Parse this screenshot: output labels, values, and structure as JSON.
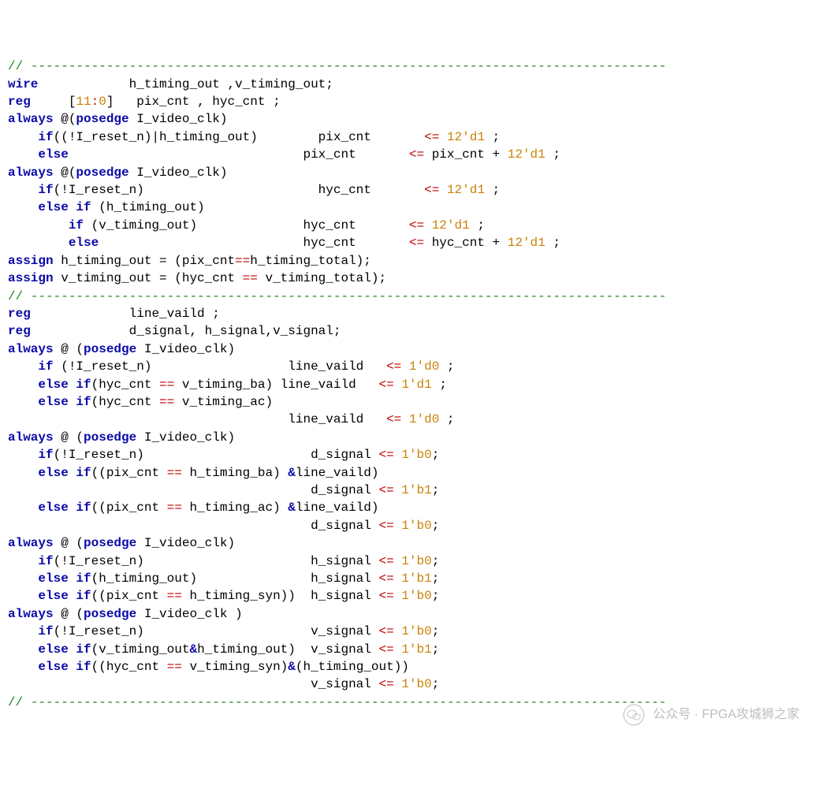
{
  "tokens": [
    [
      [
        "c",
        "// ------------------------------------------------------------------------------------"
      ]
    ],
    [
      [
        "k",
        "wire"
      ],
      [
        "",
        "            h_timing_out ,v_timing_out;"
      ]
    ],
    [
      [
        "k",
        "reg"
      ],
      [
        "",
        "     ["
      ],
      [
        "o",
        "11"
      ],
      [
        "r",
        ":"
      ],
      [
        "o",
        "0"
      ],
      [
        "",
        "]   pix_cnt , hyc_cnt ;"
      ]
    ],
    [
      [
        "k",
        "always"
      ],
      [
        "",
        " @("
      ],
      [
        "k",
        "posedge"
      ],
      [
        "",
        " I_video_clk)"
      ]
    ],
    [
      [
        "",
        "    "
      ],
      [
        "k",
        "if"
      ],
      [
        "",
        "((!I_reset_n)|h_timing_out)        pix_cnt       "
      ],
      [
        "r",
        "<="
      ],
      [
        "",
        " "
      ],
      [
        "o",
        "12'd1"
      ],
      [
        "",
        " ;"
      ]
    ],
    [
      [
        "",
        "    "
      ],
      [
        "k",
        "else"
      ],
      [
        "",
        "                               pix_cnt       "
      ],
      [
        "r",
        "<="
      ],
      [
        "",
        " pix_cnt + "
      ],
      [
        "o",
        "12'd1"
      ],
      [
        "",
        " ;"
      ]
    ],
    [
      [
        "k",
        "always"
      ],
      [
        "",
        " @("
      ],
      [
        "k",
        "posedge"
      ],
      [
        "",
        " I_video_clk)"
      ]
    ],
    [
      [
        "",
        "    "
      ],
      [
        "k",
        "if"
      ],
      [
        "",
        "(!I_reset_n)                       hyc_cnt       "
      ],
      [
        "r",
        "<="
      ],
      [
        "",
        " "
      ],
      [
        "o",
        "12'd1"
      ],
      [
        "",
        " ;"
      ]
    ],
    [
      [
        "",
        "    "
      ],
      [
        "k",
        "else if"
      ],
      [
        "",
        " (h_timing_out)"
      ]
    ],
    [
      [
        "",
        "        "
      ],
      [
        "k",
        "if"
      ],
      [
        "",
        " (v_timing_out)              hyc_cnt       "
      ],
      [
        "r",
        "<="
      ],
      [
        "",
        " "
      ],
      [
        "o",
        "12'd1"
      ],
      [
        "",
        " ;"
      ]
    ],
    [
      [
        "",
        "        "
      ],
      [
        "k",
        "else"
      ],
      [
        "",
        "                           hyc_cnt       "
      ],
      [
        "r",
        "<="
      ],
      [
        "",
        " hyc_cnt + "
      ],
      [
        "o",
        "12'd1"
      ],
      [
        "",
        " ;"
      ]
    ],
    [
      [
        "k",
        "assign"
      ],
      [
        "",
        " h_timing_out = (pix_cnt"
      ],
      [
        "r",
        "=="
      ],
      [
        "",
        "h_timing_total);"
      ]
    ],
    [
      [
        "k",
        "assign"
      ],
      [
        "",
        " v_timing_out = (hyc_cnt "
      ],
      [
        "r",
        "=="
      ],
      [
        "",
        " v_timing_total);"
      ]
    ],
    [
      [
        "c",
        "// ------------------------------------------------------------------------------------"
      ]
    ],
    [
      [
        "k",
        "reg"
      ],
      [
        "",
        "             line_vaild ;"
      ]
    ],
    [
      [
        "k",
        "reg"
      ],
      [
        "",
        "             d_signal, h_signal,v_signal;"
      ]
    ],
    [
      [
        "k",
        "always"
      ],
      [
        "",
        " @ ("
      ],
      [
        "k",
        "posedge"
      ],
      [
        "",
        " I_video_clk)"
      ]
    ],
    [
      [
        "",
        "    "
      ],
      [
        "k",
        "if"
      ],
      [
        "",
        " (!I_reset_n)                  line_vaild   "
      ],
      [
        "r",
        "<="
      ],
      [
        "",
        " "
      ],
      [
        "o",
        "1'd0"
      ],
      [
        "",
        " ;"
      ]
    ],
    [
      [
        "",
        "    "
      ],
      [
        "k",
        "else if"
      ],
      [
        "",
        "(hyc_cnt "
      ],
      [
        "r",
        "=="
      ],
      [
        "",
        " v_timing_ba) line_vaild   "
      ],
      [
        "r",
        "<="
      ],
      [
        "",
        " "
      ],
      [
        "o",
        "1'd1"
      ],
      [
        "",
        " ;"
      ]
    ],
    [
      [
        "",
        "    "
      ],
      [
        "k",
        "else if"
      ],
      [
        "",
        "(hyc_cnt "
      ],
      [
        "r",
        "=="
      ],
      [
        "",
        " v_timing_ac)"
      ]
    ],
    [
      [
        "",
        "                                     line_vaild   "
      ],
      [
        "r",
        "<="
      ],
      [
        "",
        " "
      ],
      [
        "o",
        "1'd0"
      ],
      [
        "",
        " ;"
      ]
    ],
    [
      [
        "k",
        "always"
      ],
      [
        "",
        " @ ("
      ],
      [
        "k",
        "posedge"
      ],
      [
        "",
        " I_video_clk)"
      ]
    ],
    [
      [
        "",
        "    "
      ],
      [
        "k",
        "if"
      ],
      [
        "",
        "(!I_reset_n)                      d_signal "
      ],
      [
        "r",
        "<="
      ],
      [
        "",
        " "
      ],
      [
        "o",
        "1'b0"
      ],
      [
        "",
        ";"
      ]
    ],
    [
      [
        "",
        "    "
      ],
      [
        "k",
        "else if"
      ],
      [
        "",
        "((pix_cnt "
      ],
      [
        "r",
        "=="
      ],
      [
        "",
        " h_timing_ba) "
      ],
      [
        "k",
        "&"
      ],
      [
        "",
        "line_vaild)"
      ]
    ],
    [
      [
        "",
        "                                        d_signal "
      ],
      [
        "r",
        "<="
      ],
      [
        "",
        " "
      ],
      [
        "o",
        "1'b1"
      ],
      [
        "",
        ";"
      ]
    ],
    [
      [
        "",
        "    "
      ],
      [
        "k",
        "else if"
      ],
      [
        "",
        "((pix_cnt "
      ],
      [
        "r",
        "=="
      ],
      [
        "",
        " h_timing_ac) "
      ],
      [
        "k",
        "&"
      ],
      [
        "",
        "line_vaild)"
      ]
    ],
    [
      [
        "",
        "                                        d_signal "
      ],
      [
        "r",
        "<="
      ],
      [
        "",
        " "
      ],
      [
        "o",
        "1'b0"
      ],
      [
        "",
        ";"
      ]
    ],
    [
      [
        "k",
        "always"
      ],
      [
        "",
        " @ ("
      ],
      [
        "k",
        "posedge"
      ],
      [
        "",
        " I_video_clk)"
      ]
    ],
    [
      [
        "",
        "    "
      ],
      [
        "k",
        "if"
      ],
      [
        "",
        "(!I_reset_n)                      h_signal "
      ],
      [
        "r",
        "<="
      ],
      [
        "",
        " "
      ],
      [
        "o",
        "1'b0"
      ],
      [
        "",
        ";"
      ]
    ],
    [
      [
        "",
        "    "
      ],
      [
        "k",
        "else if"
      ],
      [
        "",
        "(h_timing_out)               h_signal "
      ],
      [
        "r",
        "<="
      ],
      [
        "",
        " "
      ],
      [
        "o",
        "1'b1"
      ],
      [
        "",
        ";"
      ]
    ],
    [
      [
        "",
        "    "
      ],
      [
        "k",
        "else if"
      ],
      [
        "",
        "((pix_cnt "
      ],
      [
        "r",
        "=="
      ],
      [
        "",
        " h_timing_syn))  h_signal "
      ],
      [
        "r",
        "<="
      ],
      [
        "",
        " "
      ],
      [
        "o",
        "1'b0"
      ],
      [
        "",
        ";"
      ]
    ],
    [
      [
        "k",
        "always"
      ],
      [
        "",
        " @ ("
      ],
      [
        "k",
        "posedge"
      ],
      [
        "",
        " I_video_clk )"
      ]
    ],
    [
      [
        "",
        "    "
      ],
      [
        "k",
        "if"
      ],
      [
        "",
        "(!I_reset_n)                      v_signal "
      ],
      [
        "r",
        "<="
      ],
      [
        "",
        " "
      ],
      [
        "o",
        "1'b0"
      ],
      [
        "",
        ";"
      ]
    ],
    [
      [
        "",
        "    "
      ],
      [
        "k",
        "else if"
      ],
      [
        "",
        "(v_timing_out"
      ],
      [
        "k",
        "&"
      ],
      [
        "",
        "h_timing_out)  v_signal "
      ],
      [
        "r",
        "<="
      ],
      [
        "",
        " "
      ],
      [
        "o",
        "1'b1"
      ],
      [
        "",
        ";"
      ]
    ],
    [
      [
        "",
        "    "
      ],
      [
        "k",
        "else if"
      ],
      [
        "",
        "((hyc_cnt "
      ],
      [
        "r",
        "=="
      ],
      [
        "",
        " v_timing_syn)"
      ],
      [
        "k",
        "&"
      ],
      [
        "",
        "(h_timing_out))"
      ]
    ],
    [
      [
        "",
        "                                        v_signal "
      ],
      [
        "r",
        "<="
      ],
      [
        "",
        " "
      ],
      [
        "o",
        "1'b0"
      ],
      [
        "",
        ";"
      ]
    ],
    [
      [
        "c",
        "// ------------------------------------------------------------------------------------"
      ]
    ]
  ],
  "watermark": "公众号 · FPGA攻城狮之家"
}
